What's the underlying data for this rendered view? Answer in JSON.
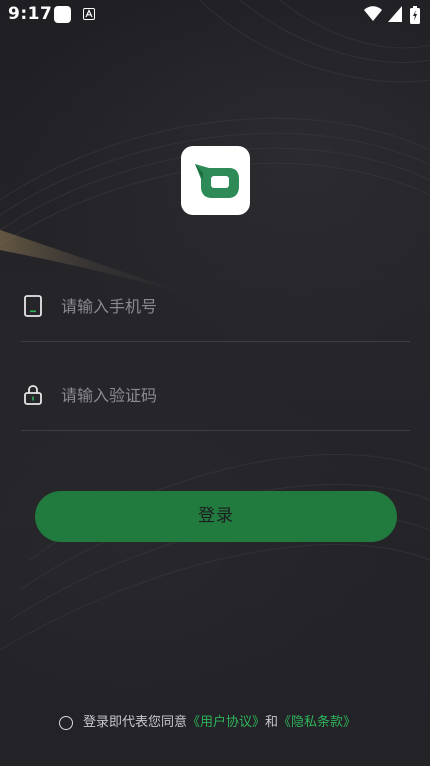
{
  "status_bar": {
    "time": "9:17",
    "icons": [
      "app-notification-icon",
      "a-text-icon",
      "wifi-icon",
      "signal-icon",
      "battery-icon"
    ]
  },
  "logo": {
    "icon": "app-logo-icon",
    "accent_color": "#2e8b57"
  },
  "login_form": {
    "phone": {
      "icon": "phone-icon",
      "placeholder": "请输入手机号",
      "value": ""
    },
    "code": {
      "icon": "lock-icon",
      "placeholder": "请输入验证码",
      "value": ""
    },
    "submit_label": "登录",
    "button_color": "#217a3e"
  },
  "agreement": {
    "prefix": "登录即代表您同意",
    "user_agreement": "《用户协议》",
    "conjunction": "和",
    "privacy_terms": "《隐私条款》",
    "checked": false,
    "link_color": "#2fb35a"
  }
}
